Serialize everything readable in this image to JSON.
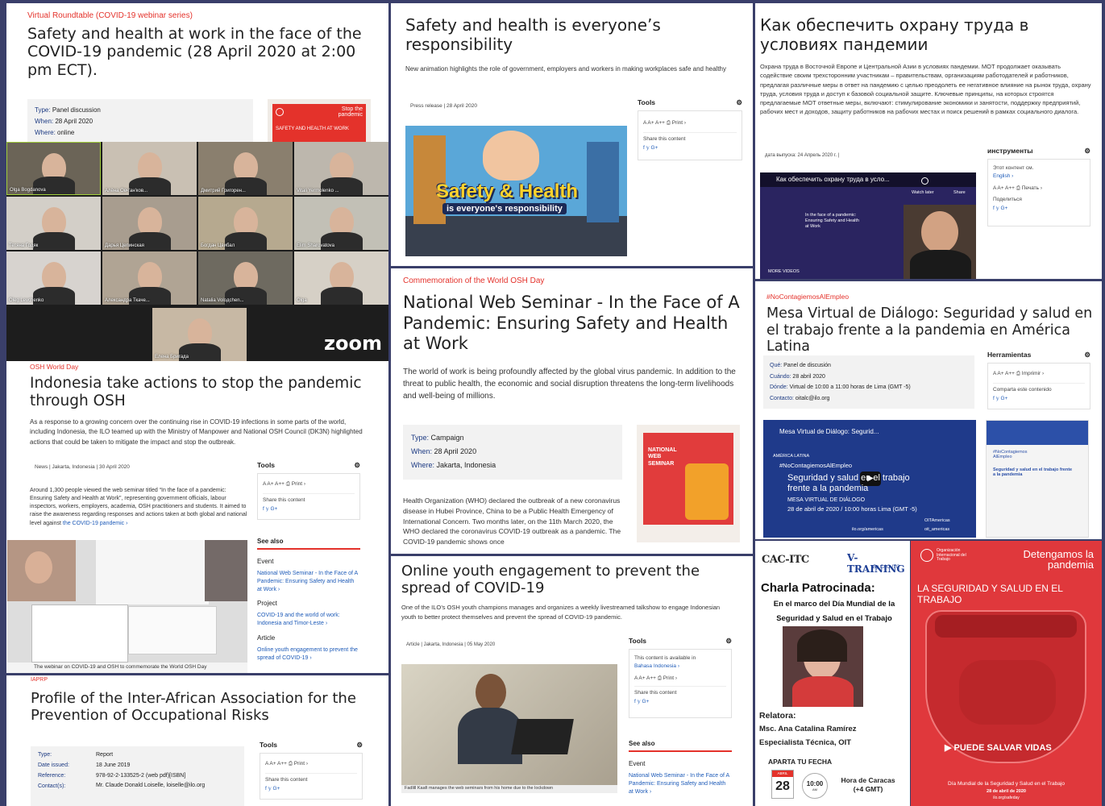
{
  "p1": {
    "kicker": "Virtual Roundtable (COVID-19 webinar series)",
    "title": "Safety and health at work in the face of the COVID-19 pandemic (28 April 2020 at 2:00 pm ECT).",
    "meta": [
      {
        "k": "Type:",
        "v": "Panel discussion"
      },
      {
        "k": "When:",
        "v": "28 April 2020"
      },
      {
        "k": "Where:",
        "v": "online"
      }
    ],
    "banner": "SAFETY AND HEALTH AT WORK",
    "banner_tag": "Stop the pandemic"
  },
  "zoom": {
    "logo": "zoom",
    "names": [
      "Olga Bogdanova",
      "Алёна Овч'ан'ков...",
      "Дмитрий Григорен...",
      "Vitali Yermolenko ...",
      "Тетяна Годяк",
      "Дарья Цепинская",
      "Богдан Цвибал",
      "Elim Sharovatova",
      "Oleg Levchenko",
      "Александра Ткаче...",
      "Natalia Voloдchen...",
      "Olga",
      "Елена Бригада"
    ]
  },
  "p2": {
    "title": "Safety and health is everyone’s responsibility",
    "sub": "New animation highlights the role of government, employers and workers in making workplaces safe and healthy",
    "date": "Press release | 28 April 2020",
    "tools": "Tools",
    "font": "A  A+  A++  ⎙ Print ›",
    "share": "Share this content",
    "social": "f  𝕪  G+",
    "img1": "Safety & Health",
    "img2": "is everyone's responsibility"
  },
  "p3": {
    "title": "Как обеспечить охрану труда в условиях пандемии",
    "text": "Охрана труда в Восточной Европе и Центральной Азии в условиях пандемии. МОТ продолжает оказывать содействие своим трехсторонним участникам – правительствам, организациям работодателей и работников, предлагая различные меры в ответ на пандемию с целью преодолеть ее негативное влияние на рынок труда, охрану труда, условия труда и доступ к базовой социальной защите. Ключевые принципы, на которых строятся предлагаемые МОТ ответные меры, включают: стимулирование экономики и занятости, поддержку предприятий, рабочих мест и доходов, защиту работников на рабочих местах и поиск решений в рамках социального диалога.",
    "date": "дата выпуска: 24 Апрель 2020 г. |",
    "tools": "инструменты",
    "avail": "Этот контент см.",
    "lang": "English ›",
    "font": "A  A+  A++  ⎙ Печать ›",
    "share": "Поделиться",
    "social": "f  𝕪  G+",
    "video_title": "Как обеспечить охрану труда в усло...",
    "watch": "Watch later",
    "share_btn": "Share",
    "more": "MORE VIDEOS",
    "video_text": "In the face of a pandemic: Ensuring Safety and Health at Work"
  },
  "p4": {
    "kicker": "Commemoration of the World OSH Day",
    "title": "National Web Seminar - In the Face of A Pandemic: Ensuring Safety and Health at Work",
    "sub": "The world of work is being profoundly affected by the global virus pandemic. In addition to the threat to public health, the economic and social disruption threatens the long-term livelihoods and well-being of millions.",
    "meta": [
      {
        "k": "Type:",
        "v": "Campaign"
      },
      {
        "k": "When:",
        "v": "28 April 2020"
      },
      {
        "k": "Where:",
        "v": "Jakarta, Indonesia"
      }
    ],
    "body": "Health Organization (WHO) declared the outbreak of a new coronavirus disease in Hubei Province, China to be a Public Health Emergency of International Concern. Two months later, on the 11th March 2020, the WHO declared the coronavirus COVID-19 outbreak as a pandemic. The COVID-19 pandemic shows once",
    "poster": "NATIONAL WEB SEMINAR"
  },
  "p5": {
    "kicker": "#NoContagiemosAlEmpleo",
    "title": "Mesa Virtual de Diálogo: Seguridad y salud en el trabajo frente a la pandemia en América Latina",
    "meta": [
      {
        "k": "Qué:",
        "v": "Panel de discusión"
      },
      {
        "k": "Cuándo:",
        "v": "28 abril 2020"
      },
      {
        "k": "Dónde:",
        "v": "Virtual de 10:00 a 11:00 horas de Lima (GMT -5)"
      },
      {
        "k": "Contacto:",
        "v": "oitalc@ilo.org"
      }
    ],
    "tools": "Herramientas",
    "font": "A  A+  A++  ⎙ Imprimir ›",
    "share": "Comparta este contenido",
    "social": "f  𝕪  G+",
    "v_title": "Mesa Virtual de Diálogo: Segurid...",
    "v_region": "AMÉRICA LATINA",
    "v_tag": "#NoContagiemosAlEmpleo",
    "v_head": "Seguridad y salud en el trabajo frente a la pandemia",
    "v_sub": "MESA VIRTUAL DE DIÁLOGO",
    "v_date": "28 de abril de 2020 / 10:00 horas Lima (GMT -5)",
    "v_foot": "ilo.org/americas",
    "v_tw": "OITAmericas",
    "v_ig": "oit_americas",
    "doc_title": "Seguridad y salud en el trabajo frente a la pandemia",
    "doc_tag": "#NoContagiemos AlEmpleo"
  },
  "p6": {
    "kicker": "OSH World Day",
    "title": "Indonesia take actions to stop the pandemic through OSH",
    "sub": "As a response to a growing concern over the continuing rise in COVID-19 infections in some parts of the world, including Indonesia, the ILO teamed up with the Ministry of Manpower and National OSH Council (DK3N) highlighted actions that could be taken to mitigate the impact and stop the outbreak.",
    "date": "News | Jakarta, Indonesia | 30 April 2020",
    "body": "Around 1,300 people viewed the web seminar titled “In the face of a pandemic: Ensuring Safety and Health at Work”, representing government officials, labour inspectors, workers, employers, academia, OSH practitioners and students. It aimed to raise the awareness regarding responses and actions taken at both global and national level against",
    "link": "the COVID-19 pandemic ›",
    "caption": "The webinar on COVID-19 and OSH to commemorate the World OSH Day",
    "tools": "Tools",
    "font": "A  A+  A++  ⎙ Print ›",
    "share": "Share this content",
    "social": "f  𝕪  G+",
    "see": "See also",
    "s1": "Event",
    "s1l": "National Web Seminar - In the Face of A Pandemic: Ensuring Safety and Health at Work ›",
    "s2": "Project",
    "s2l": "COVID-19 and the world of work: Indonesia and Timor-Leste ›",
    "s3": "Article",
    "s3l": "Online youth engagement to prevent the spread of COVID-19 ›"
  },
  "p7": {
    "kicker": "IAPRP",
    "title": "Profile of the Inter-African Association for the Prevention of Occupational Risks",
    "meta": [
      {
        "k": "Type:",
        "v": "Report"
      },
      {
        "k": "Date issued:",
        "v": "18 June 2019"
      },
      {
        "k": "Reference:",
        "v": "978-92-2-133525-2 (web pdf)[ISBN]"
      },
      {
        "k": "Contact(s):",
        "v": "Mr. Claude Donald Loiselle, loiselle@ilo.org"
      }
    ],
    "tools": "Tools",
    "font": "A  A+  A++  ⎙ Print ›",
    "share": "Share this content",
    "social": "f  𝕪  G+"
  },
  "p8": {
    "title": "Online youth engagement to prevent the spread of COVID-19",
    "sub": "One of the ILO’s OSH youth champions manages and organizes a weekly livestreamed talkshow to engage Indonesian youth to better protect themselves and prevent the spread of COVID-19 pandemic.",
    "date": "Article | Jakarta, Indonesia | 05 May 2020",
    "caption": "Fadlill Kaafi manages the web seminars from his home due to the lockdown",
    "tools": "Tools",
    "avail": "This content is available in",
    "lang": "Bahasa Indonesia ›",
    "font": "A  A+  A++  ⎙ Print ›",
    "share": "Share this content",
    "social": "f  𝕪  G+",
    "see": "See also",
    "s1": "Event",
    "s1l": "National Web Seminar - In the Face of A Pandemic: Ensuring Safety and Health at Work ›"
  },
  "p9": {
    "logo1": "CAC-ITC",
    "logo2": "V-TRAINING",
    "logo2sub": "By CAC-ITC",
    "title": "Charla Patrocinada:",
    "sub": "En el marco del Día Mundial de la Seguridad y Salud en el Trabajo",
    "rel": "Relatora:",
    "name": "Msc. Ana Catalina Ramírez",
    "role": "Especialista Técnica, OIT",
    "save": "APARTA TU FECHA",
    "month": "ABRIL",
    "day": "28",
    "time": "10:00",
    "ampm": "AM",
    "tz": "Hora de Caracas (+4 GMT)"
  },
  "p10": {
    "org": "Organización Internacional del Trabajo",
    "tag": "Detengamos la pandemia",
    "head": "LA SEGURIDAD Y SALUD EN EL TRABAJO",
    "cta": "▶ PUEDE SALVAR VIDAS",
    "foot": "Día Mundial de la Seguridad y Salud en el Trabajo",
    "fdate": "28 de abril de 2020",
    "url": "ilo.org/safeday"
  }
}
